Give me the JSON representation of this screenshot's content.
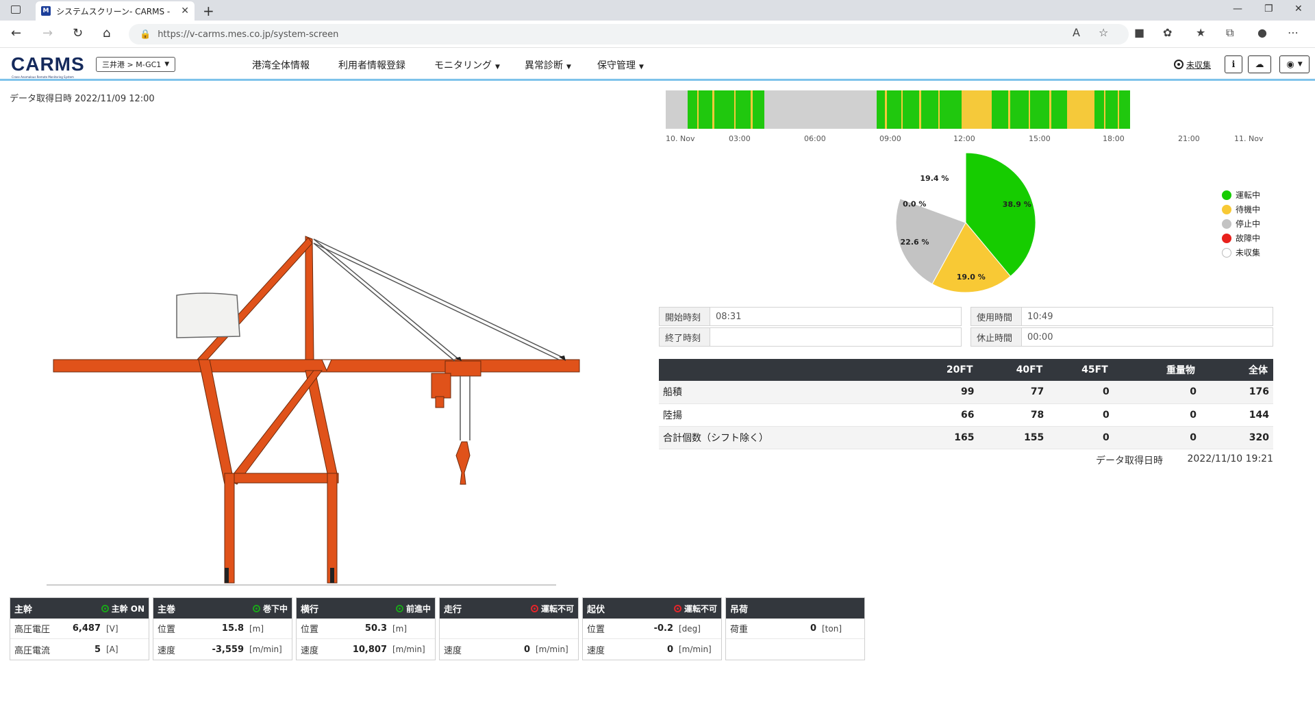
{
  "browser": {
    "tab_title": "システムスクリーン- CARMS -",
    "tab_favicon": "M",
    "url": "https://v-carms.mes.co.jp/system-screen"
  },
  "header": {
    "logo": "CARMS",
    "logo_sub": "Crane Anomalous Remote Monitoring System",
    "breadcrumb": "三井港 > M-GC1",
    "menu": [
      {
        "label": "港湾全体情報",
        "dropdown": false
      },
      {
        "label": "利用者情報登録",
        "dropdown": false
      },
      {
        "label": "モニタリング",
        "dropdown": true
      },
      {
        "label": "異常診断",
        "dropdown": true
      },
      {
        "label": "保守管理",
        "dropdown": true
      }
    ],
    "uncollected_label": "未収集"
  },
  "left": {
    "data_time_label": "データ取得日時",
    "data_time_value": "2022/11/09 12:00"
  },
  "timeline": {
    "tick_labels": [
      "10. Nov",
      "03:00",
      "06:00",
      "09:00",
      "12:00",
      "15:00",
      "18:00",
      "21:00",
      "11. Nov"
    ],
    "colors": {
      "running": "#20c80e",
      "waiting": "#f5c93a",
      "stopped": "#cfcfcf",
      "uncollected": "#ffffff"
    }
  },
  "pie": {
    "slices": [
      {
        "label": "38.9 %",
        "value": 38.9,
        "color": "#16cc00"
      },
      {
        "label": "19.0 %",
        "value": 19.0,
        "color": "#f8c935"
      },
      {
        "label": "22.6 %",
        "value": 22.6,
        "color": "#c3c3c3"
      },
      {
        "label": "0.0 %",
        "value": 0.0,
        "color": "#e8211c"
      },
      {
        "label": "19.4 %",
        "value": 19.4,
        "color": "#ffffff"
      }
    ],
    "legend": [
      {
        "label": "運転中",
        "color": "#16cc00"
      },
      {
        "label": "待機中",
        "color": "#f8c935"
      },
      {
        "label": "停止中",
        "color": "#c3c3c3"
      },
      {
        "label": "故障中",
        "color": "#e8211c"
      },
      {
        "label": "未収集",
        "color": "#ffffff"
      }
    ]
  },
  "times": {
    "start_label": "開始時刻",
    "start_value": "08:31",
    "end_label": "終了時刻",
    "end_value": "",
    "use_label": "使用時間",
    "use_value": "10:49",
    "rest_label": "休止時間",
    "rest_value": "00:00"
  },
  "counts": {
    "headers": [
      "",
      "20FT",
      "40FT",
      "45FT",
      "重量物",
      "全体"
    ],
    "rows": [
      [
        "船積",
        "99",
        "77",
        "0",
        "0",
        "176"
      ],
      [
        "陸揚",
        "66",
        "78",
        "0",
        "0",
        "144"
      ],
      [
        "合計個数（シフト除く）",
        "165",
        "155",
        "0",
        "0",
        "320"
      ]
    ],
    "data_time_label": "データ取得日時",
    "data_time_value": "2022/11/10 19:21"
  },
  "cards": [
    {
      "title": "主幹",
      "status": "主幹 ON",
      "status_color": "#1aa51a",
      "rows": [
        {
          "k": "高圧電圧",
          "v": "6,487",
          "u": "[V]"
        },
        {
          "k": "高圧電流",
          "v": "5",
          "u": "[A]"
        }
      ]
    },
    {
      "title": "主巻",
      "status": "巻下中",
      "status_color": "#1aa51a",
      "rows": [
        {
          "k": "位置",
          "v": "15.8",
          "u": "[m]"
        },
        {
          "k": "速度",
          "v": "-3,559",
          "u": "[m/min]"
        }
      ]
    },
    {
      "title": "横行",
      "status": "前進中",
      "status_color": "#1aa51a",
      "rows": [
        {
          "k": "位置",
          "v": "50.3",
          "u": "[m]"
        },
        {
          "k": "速度",
          "v": "10,807",
          "u": "[m/min]"
        }
      ]
    },
    {
      "title": "走行",
      "status": "運転不可",
      "status_color": "#e2262b",
      "rows": [
        {
          "k": "",
          "v": "",
          "u": ""
        },
        {
          "k": "速度",
          "v": "0",
          "u": "[m/min]"
        }
      ]
    },
    {
      "title": "起伏",
      "status": "運転不可",
      "status_color": "#e2262b",
      "rows": [
        {
          "k": "位置",
          "v": "-0.2",
          "u": "[deg]"
        },
        {
          "k": "速度",
          "v": "0",
          "u": "[m/min]"
        }
      ]
    },
    {
      "title": "吊荷",
      "status": "",
      "status_color": "",
      "rows": [
        {
          "k": "荷重",
          "v": "0",
          "u": "[ton]"
        },
        {
          "k": "",
          "v": "",
          "u": ""
        }
      ]
    }
  ]
}
